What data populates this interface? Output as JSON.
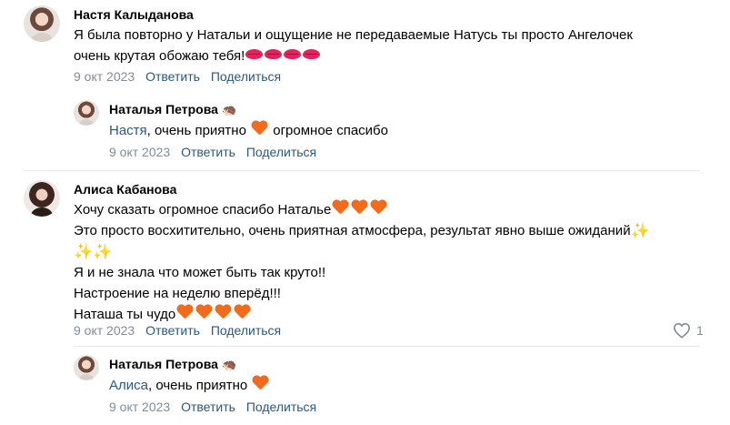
{
  "comments": [
    {
      "author": "Настя Калыданова",
      "lines": [
        "Я была повторно у Натальи и ощущение не передаваемые Натусь ты просто Ангелочек",
        "очень крутая обожаю тебя!"
      ],
      "emoji_after_line2": [
        "kiss-mark-icon",
        "kiss-mark-icon",
        "kiss-mark-icon",
        "kiss-mark-icon"
      ],
      "date": "9 окт 2023",
      "reply_label": "Ответить",
      "share_label": "Поделиться",
      "reply": {
        "author": "Наталья Петрова",
        "author_badge": "hedgehog-icon",
        "mention": "Настя",
        "text_before_heart": ", очень приятно ",
        "text_after_heart": " огромное спасибо",
        "date": "9 окт 2023",
        "reply_label": "Ответить",
        "share_label": "Поделиться"
      }
    },
    {
      "author": "Алиса Кабанова",
      "line1": "Хочу сказать огромное спасибо Наталье",
      "line2": "Это просто восхитительно, очень приятная атмосфера, результат явно выше ожиданий",
      "line4": "Я и не знала что может быть так круто!!",
      "line5": "Настроение на неделю вперёд!!!",
      "line6": "Наташа ты чудо",
      "date": "9 окт 2023",
      "reply_label": "Ответить",
      "share_label": "Поделиться",
      "likes": "1",
      "reply": {
        "author": "Наталья Петрова",
        "author_badge": "hedgehog-icon",
        "mention": "Алиса",
        "text_before_heart": ", очень приятно ",
        "date": "9 окт 2023",
        "reply_label": "Ответить",
        "share_label": "Поделиться"
      }
    }
  ],
  "colors": {
    "link": "#2a5885",
    "meta": "#818c99",
    "heart": "#f26b1d",
    "divider": "#e7e8ec"
  }
}
